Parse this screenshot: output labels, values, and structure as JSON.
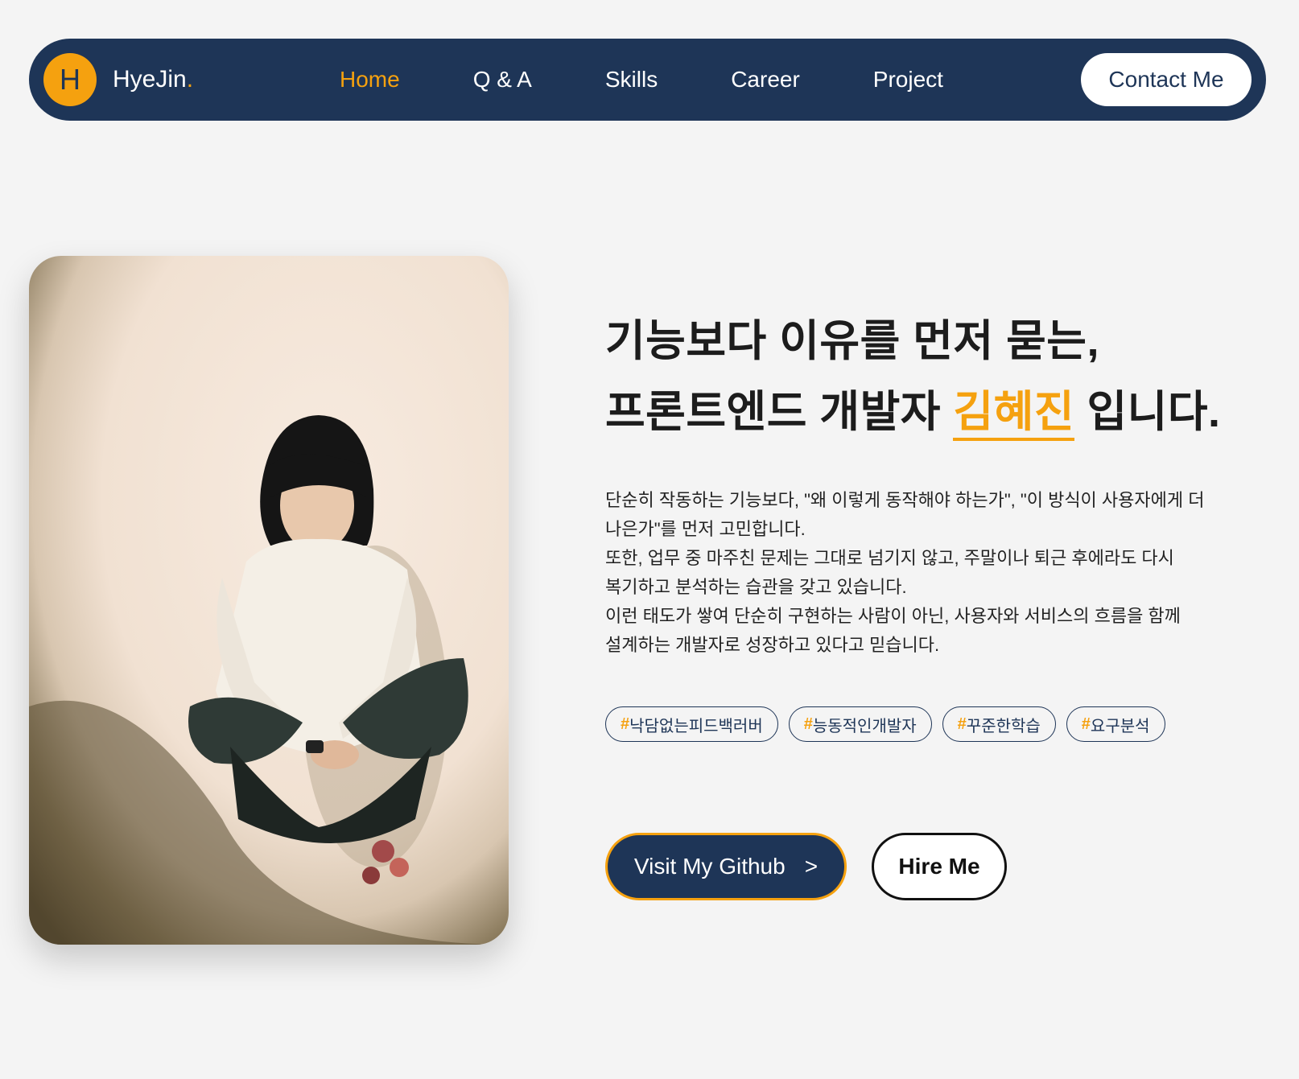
{
  "nav": {
    "avatar_letter": "H",
    "brand_name": "HyeJin",
    "brand_dot": ".",
    "links": [
      {
        "label": "Home",
        "active": true
      },
      {
        "label": "Q & A",
        "active": false
      },
      {
        "label": "Skills",
        "active": false
      },
      {
        "label": "Career",
        "active": false
      },
      {
        "label": "Project",
        "active": false
      }
    ],
    "contact_label": "Contact Me"
  },
  "hero": {
    "title_line1": "기능보다 이유를 먼저 묻는,",
    "title_line2_prefix": "프론트엔드 개발자 ",
    "title_name": "김혜진",
    "title_line2_suffix": " 입니다.",
    "description": [
      "단순히 작동하는 기능보다, \"왜 이렇게 동작해야 하는가\", \"이 방식이 사용자에게 더",
      "나은가\"를 먼저 고민합니다.",
      "또한, 업무 중 마주친 문제는 그대로 넘기지 않고, 주말이나 퇴근 후에라도 다시",
      "복기하고 분석하는 습관을 갖고 있습니다.",
      "이런 태도가 쌓여 단순히 구현하는 사람이 아닌, 사용자와 서비스의 흐름을 함께",
      "설계하는 개발자로 성장하고 있다고 믿습니다."
    ],
    "tags": [
      {
        "hash": "#",
        "text": "낙담없는피드백러버"
      },
      {
        "hash": "#",
        "text": "능동적인개발자"
      },
      {
        "hash": "#",
        "text": "꾸준한학습"
      },
      {
        "hash": "#",
        "text": "요구분석"
      }
    ],
    "github_label": "Visit My Github",
    "github_arrow": ">",
    "hire_label": "Hire Me"
  },
  "colors": {
    "navy": "#1e3557",
    "accent": "#f5a10f",
    "background": "#f4f4f4"
  },
  "icons": {
    "photo": "portrait-photo"
  }
}
